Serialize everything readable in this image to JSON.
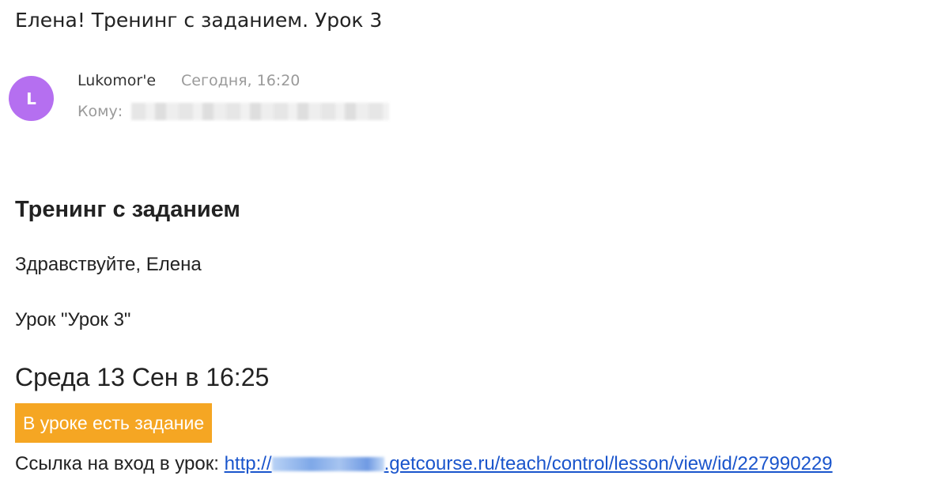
{
  "email": {
    "subject": "Елена! Тренинг с заданием. Урок 3",
    "sender": {
      "avatar_letter": "L",
      "avatar_color": "#b56ff0",
      "name": "Lukomor'e",
      "date": "Сегодня, 16:20"
    },
    "recipient": {
      "label": "Кому:"
    }
  },
  "body": {
    "heading": "Тренинг с заданием",
    "greeting": "Здравствуйте, Елена",
    "lesson": "Урок \"Урок 3\"",
    "lesson_date": "Среда 13 Сен в 16:25",
    "task_badge": "В уроке есть задание",
    "task_badge_color": "#f5a623",
    "link_label": "Ссылка на вход в урок:",
    "link_prefix": "http://",
    "link_suffix": ".getcourse.ru/teach/control/lesson/view/id/227990229",
    "link_color": "#1a55cc"
  }
}
